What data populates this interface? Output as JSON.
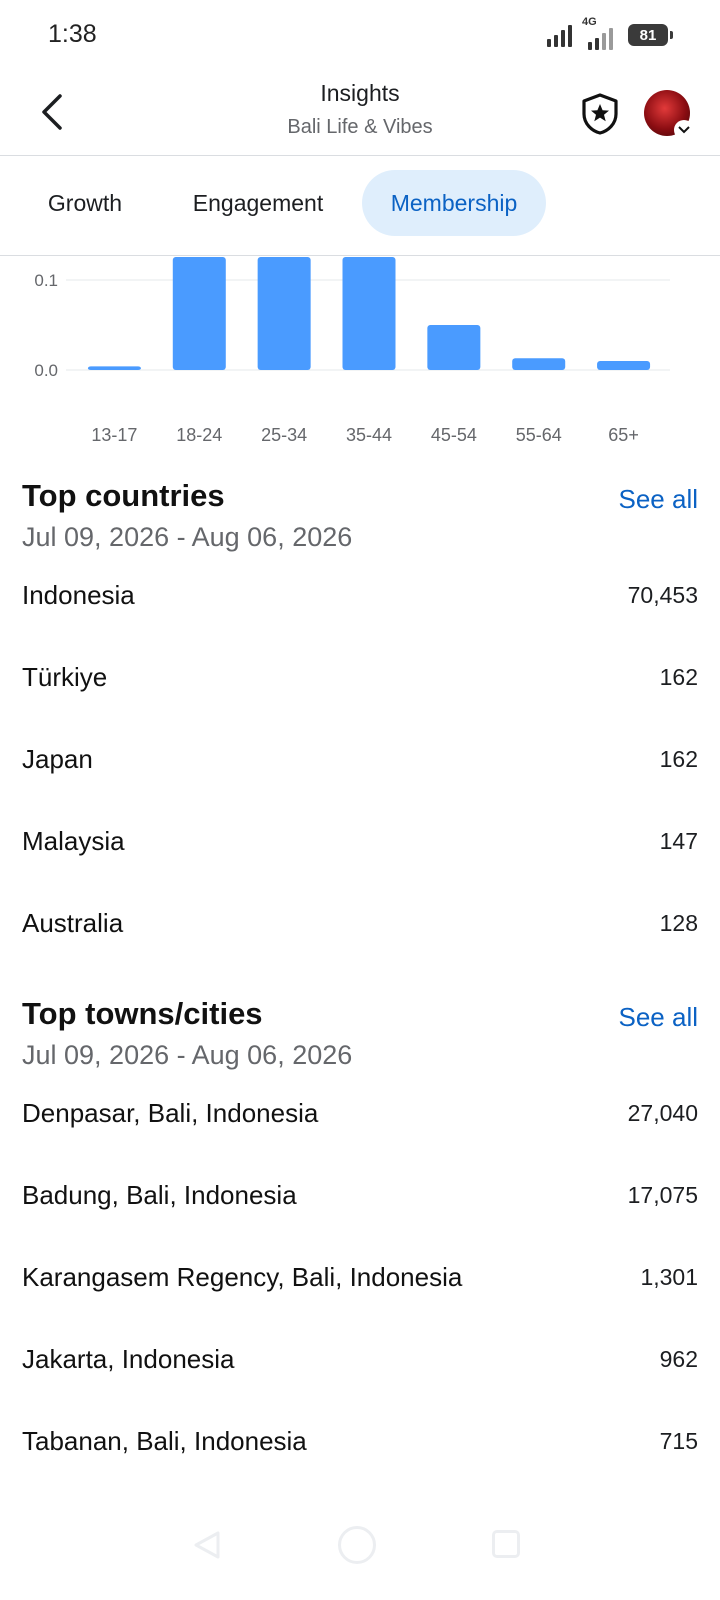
{
  "status_bar": {
    "time": "1:38",
    "network_type": "4G",
    "battery_level": "81"
  },
  "header": {
    "title": "Insights",
    "subtitle": "Bali Life & Vibes",
    "back_icon": "chevron-left-icon",
    "shield_icon": "shield-star-icon",
    "avatar_badge_icon": "chevron-down-icon"
  },
  "tabs": [
    {
      "label": "Growth",
      "selected": false
    },
    {
      "label": "Engagement",
      "selected": false
    },
    {
      "label": "Membership",
      "selected": true
    }
  ],
  "chart_data": {
    "type": "bar",
    "categories": [
      "13-17",
      "18-24",
      "25-34",
      "35-44",
      "45-54",
      "55-64",
      "65+"
    ],
    "values": [
      0.004,
      0.135,
      0.135,
      0.135,
      0.05,
      0.013,
      0.01
    ],
    "yticks": [
      0.0,
      0.1
    ],
    "ytick_labels": [
      "0.0",
      "0.1"
    ],
    "ylim_visible": [
      0.0,
      0.135
    ],
    "grid": true,
    "bar_color": "#4a9bff"
  },
  "top_countries": {
    "title": "Top countries",
    "see_all": "See all",
    "dates": "Jul 09, 2026 - Aug 06, 2026",
    "rows": [
      {
        "name": "Indonesia",
        "value": "70,453"
      },
      {
        "name": "Türkiye",
        "value": "162"
      },
      {
        "name": "Japan",
        "value": "162"
      },
      {
        "name": "Malaysia",
        "value": "147"
      },
      {
        "name": "Australia",
        "value": "128"
      }
    ]
  },
  "top_cities": {
    "title": "Top towns/cities",
    "see_all": "See all",
    "dates": "Jul 09, 2026 - Aug 06, 2026",
    "rows": [
      {
        "name": "Denpasar, Bali, Indonesia",
        "value": "27,040"
      },
      {
        "name": "Badung, Bali, Indonesia",
        "value": "17,075"
      },
      {
        "name": "Karangasem Regency, Bali, Indonesia",
        "value": "1,301"
      },
      {
        "name": "Jakarta, Indonesia",
        "value": "962"
      },
      {
        "name": "Tabanan, Bali, Indonesia",
        "value": "715"
      }
    ]
  },
  "colors": {
    "accent": "#0b62c4",
    "tab_selected_bg": "#dfeefc",
    "bar": "#4a9bff"
  }
}
